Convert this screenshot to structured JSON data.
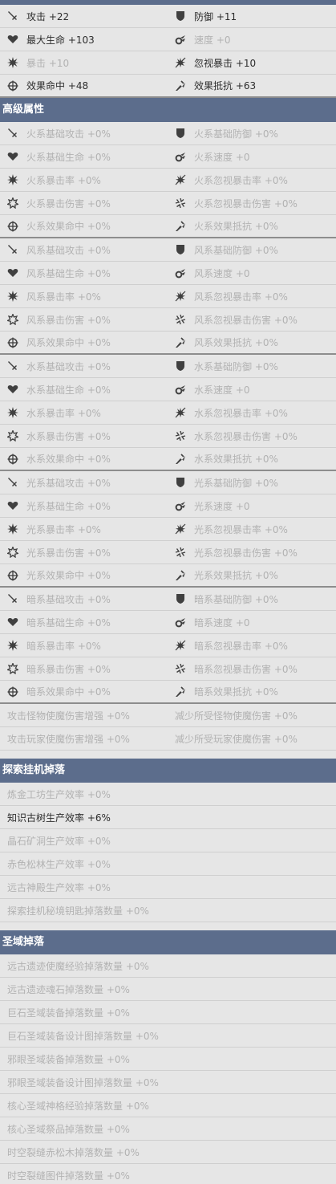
{
  "colors": {
    "header_bg": "#5c6d8c",
    "text_active": "#2d2d2d",
    "text_inactive": "#b2b2b2",
    "icon": "#404040"
  },
  "basic_stats": [
    [
      {
        "icon": "sword-icon",
        "label": "攻击 +22",
        "active": true
      },
      {
        "icon": "shield-icon",
        "label": "防御 +11",
        "active": true
      }
    ],
    [
      {
        "icon": "heart-icon",
        "label": "最大生命 +103",
        "active": true
      },
      {
        "icon": "speed-icon",
        "label": "速度 +0",
        "active": false
      }
    ],
    [
      {
        "icon": "crit-icon",
        "label": "暴击 +10",
        "active": false
      },
      {
        "icon": "ignore-crit-icon",
        "label": "忽视暴击 +10",
        "active": true
      }
    ],
    [
      {
        "icon": "target-icon",
        "label": "效果命中 +48",
        "active": true
      },
      {
        "icon": "resist-icon",
        "label": "效果抵抗 +63",
        "active": true
      }
    ]
  ],
  "advanced": {
    "title": "高级属性",
    "elements": [
      {
        "rows": [
          [
            {
              "icon": "sword-icon",
              "label": "火系基础攻击 +0%"
            },
            {
              "icon": "shield-icon",
              "label": "火系基础防御 +0%"
            }
          ],
          [
            {
              "icon": "heart-icon",
              "label": "火系基础生命 +0%"
            },
            {
              "icon": "speed-icon",
              "label": "火系速度 +0"
            }
          ],
          [
            {
              "icon": "crit-icon",
              "label": "火系暴击率 +0%"
            },
            {
              "icon": "ignore-crit-icon",
              "label": "火系忽视暴击率 +0%"
            }
          ],
          [
            {
              "icon": "crit-damage-icon",
              "label": "火系暴击伤害 +0%"
            },
            {
              "icon": "ignore-crit-damage-icon",
              "label": "火系忽视暴击伤害 +0%"
            }
          ],
          [
            {
              "icon": "target-icon",
              "label": "火系效果命中 +0%"
            },
            {
              "icon": "resist-icon",
              "label": "火系效果抵抗 +0%"
            }
          ]
        ]
      },
      {
        "rows": [
          [
            {
              "icon": "sword-icon",
              "label": "风系基础攻击 +0%"
            },
            {
              "icon": "shield-icon",
              "label": "风系基础防御 +0%"
            }
          ],
          [
            {
              "icon": "heart-icon",
              "label": "风系基础生命 +0%"
            },
            {
              "icon": "speed-icon",
              "label": "风系速度 +0"
            }
          ],
          [
            {
              "icon": "crit-icon",
              "label": "风系暴击率 +0%"
            },
            {
              "icon": "ignore-crit-icon",
              "label": "风系忽视暴击率 +0%"
            }
          ],
          [
            {
              "icon": "crit-damage-icon",
              "label": "风系暴击伤害 +0%"
            },
            {
              "icon": "ignore-crit-damage-icon",
              "label": "风系忽视暴击伤害 +0%"
            }
          ],
          [
            {
              "icon": "target-icon",
              "label": "风系效果命中 +0%"
            },
            {
              "icon": "resist-icon",
              "label": "风系效果抵抗 +0%"
            }
          ]
        ]
      },
      {
        "rows": [
          [
            {
              "icon": "sword-icon",
              "label": "水系基础攻击 +0%"
            },
            {
              "icon": "shield-icon",
              "label": "水系基础防御 +0%"
            }
          ],
          [
            {
              "icon": "heart-icon",
              "label": "水系基础生命 +0%"
            },
            {
              "icon": "speed-icon",
              "label": "水系速度 +0"
            }
          ],
          [
            {
              "icon": "crit-icon",
              "label": "水系暴击率 +0%"
            },
            {
              "icon": "ignore-crit-icon",
              "label": "水系忽视暴击率 +0%"
            }
          ],
          [
            {
              "icon": "crit-damage-icon",
              "label": "水系暴击伤害 +0%"
            },
            {
              "icon": "ignore-crit-damage-icon",
              "label": "水系忽视暴击伤害 +0%"
            }
          ],
          [
            {
              "icon": "target-icon",
              "label": "水系效果命中 +0%"
            },
            {
              "icon": "resist-icon",
              "label": "水系效果抵抗 +0%"
            }
          ]
        ]
      },
      {
        "rows": [
          [
            {
              "icon": "sword-icon",
              "label": "光系基础攻击 +0%"
            },
            {
              "icon": "shield-icon",
              "label": "光系基础防御 +0%"
            }
          ],
          [
            {
              "icon": "heart-icon",
              "label": "光系基础生命 +0%"
            },
            {
              "icon": "speed-icon",
              "label": "光系速度 +0"
            }
          ],
          [
            {
              "icon": "crit-icon",
              "label": "光系暴击率 +0%"
            },
            {
              "icon": "ignore-crit-icon",
              "label": "光系忽视暴击率 +0%"
            }
          ],
          [
            {
              "icon": "crit-damage-icon",
              "label": "光系暴击伤害 +0%"
            },
            {
              "icon": "ignore-crit-damage-icon",
              "label": "光系忽视暴击伤害 +0%"
            }
          ],
          [
            {
              "icon": "target-icon",
              "label": "光系效果命中 +0%"
            },
            {
              "icon": "resist-icon",
              "label": "光系效果抵抗 +0%"
            }
          ]
        ]
      },
      {
        "rows": [
          [
            {
              "icon": "sword-icon",
              "label": "暗系基础攻击 +0%"
            },
            {
              "icon": "shield-icon",
              "label": "暗系基础防御 +0%"
            }
          ],
          [
            {
              "icon": "heart-icon",
              "label": "暗系基础生命 +0%"
            },
            {
              "icon": "speed-icon",
              "label": "暗系速度 +0"
            }
          ],
          [
            {
              "icon": "crit-icon",
              "label": "暗系暴击率 +0%"
            },
            {
              "icon": "ignore-crit-icon",
              "label": "暗系忽视暴击率 +0%"
            }
          ],
          [
            {
              "icon": "crit-damage-icon",
              "label": "暗系暴击伤害 +0%"
            },
            {
              "icon": "ignore-crit-damage-icon",
              "label": "暗系忽视暴击伤害 +0%"
            }
          ],
          [
            {
              "icon": "target-icon",
              "label": "暗系效果命中 +0%"
            },
            {
              "icon": "resist-icon",
              "label": "暗系效果抵抗 +0%"
            }
          ]
        ]
      }
    ],
    "extra_rows": [
      [
        {
          "label": "攻击怪物使魔伤害增强 +0%"
        },
        {
          "label": "减少所受怪物使魔伤害 +0%"
        }
      ],
      [
        {
          "label": "攻击玩家使魔伤害增强 +0%"
        },
        {
          "label": "减少所受玩家使魔伤害 +0%"
        }
      ]
    ]
  },
  "idle_drops": {
    "title": "探索挂机掉落",
    "items": [
      {
        "label": "炼金工坊生产效率 +0%",
        "active": false
      },
      {
        "label": "知识古树生产效率 +6%",
        "active": true
      },
      {
        "label": "晶石矿洞生产效率 +0%",
        "active": false
      },
      {
        "label": "赤色松林生产效率 +0%",
        "active": false
      },
      {
        "label": "远古神殿生产效率 +0%",
        "active": false
      },
      {
        "label": "探索挂机秘境钥匙掉落数量 +0%",
        "active": false
      }
    ]
  },
  "holy_drops": {
    "title": "圣域掉落",
    "items": [
      {
        "label": "远古遗迹使魔经验掉落数量 +0%"
      },
      {
        "label": "远古遗迹魂石掉落数量 +0%"
      },
      {
        "label": "巨石圣域装备掉落数量 +0%"
      },
      {
        "label": "巨石圣域装备设计图掉落数量 +0%"
      },
      {
        "label": "邪眼圣域装备掉落数量 +0%"
      },
      {
        "label": "邪眼圣域装备设计图掉落数量 +0%"
      },
      {
        "label": "核心圣域神格经验掉落数量 +0%"
      },
      {
        "label": "核心圣域祭品掉落数量 +0%"
      },
      {
        "label": "时空裂缝赤松木掉落数量 +0%"
      },
      {
        "label": "时空裂缝图件掉落数量 +0%"
      }
    ]
  }
}
